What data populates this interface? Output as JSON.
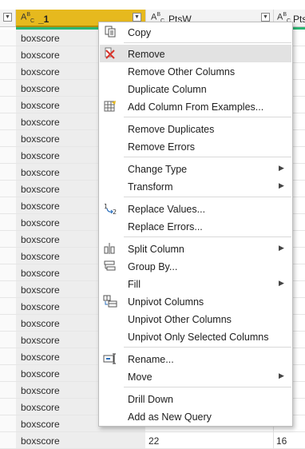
{
  "columns": [
    {
      "type_icon": "ABC",
      "name": "_1",
      "dropdown_icon": "chevron-down-icon"
    },
    {
      "type_icon": "ABC",
      "name": "PtsW",
      "dropdown_icon": "chevron-down-icon"
    },
    {
      "type_icon": "ABC",
      "name": "Pts",
      "dropdown_icon": ""
    }
  ],
  "rows": [
    {
      "c1": "boxscore",
      "c2": "",
      "c3": ""
    },
    {
      "c1": "boxscore",
      "c2": "",
      "c3": ""
    },
    {
      "c1": "boxscore",
      "c2": "",
      "c3": ""
    },
    {
      "c1": "boxscore",
      "c2": "",
      "c3": ""
    },
    {
      "c1": "boxscore",
      "c2": "",
      "c3": ""
    },
    {
      "c1": "boxscore",
      "c2": "",
      "c3": ""
    },
    {
      "c1": "boxscore",
      "c2": "",
      "c3": ""
    },
    {
      "c1": "boxscore",
      "c2": "",
      "c3": ""
    },
    {
      "c1": "boxscore",
      "c2": "",
      "c3": ""
    },
    {
      "c1": "boxscore",
      "c2": "",
      "c3": ""
    },
    {
      "c1": "boxscore",
      "c2": "",
      "c3": ""
    },
    {
      "c1": "boxscore",
      "c2": "",
      "c3": ""
    },
    {
      "c1": "boxscore",
      "c2": "",
      "c3": ""
    },
    {
      "c1": "boxscore",
      "c2": "",
      "c3": ""
    },
    {
      "c1": "boxscore",
      "c2": "",
      "c3": ""
    },
    {
      "c1": "boxscore",
      "c2": "",
      "c3": ""
    },
    {
      "c1": "boxscore",
      "c2": "",
      "c3": ""
    },
    {
      "c1": "boxscore",
      "c2": "",
      "c3": ""
    },
    {
      "c1": "boxscore",
      "c2": "",
      "c3": ""
    },
    {
      "c1": "boxscore",
      "c2": "",
      "c3": ""
    },
    {
      "c1": "boxscore",
      "c2": "",
      "c3": ""
    },
    {
      "c1": "boxscore",
      "c2": "",
      "c3": ""
    },
    {
      "c1": "boxscore",
      "c2": "",
      "c3": ""
    },
    {
      "c1": "boxscore",
      "c2": "",
      "c3": ""
    },
    {
      "c1": "boxscore",
      "c2": "22",
      "c3": "16"
    }
  ],
  "menu": {
    "copy": "Copy",
    "remove": "Remove",
    "remove_other_columns": "Remove Other Columns",
    "duplicate_column": "Duplicate Column",
    "add_column_from_examples": "Add Column From Examples...",
    "remove_duplicates": "Remove Duplicates",
    "remove_errors": "Remove Errors",
    "change_type": "Change Type",
    "transform": "Transform",
    "replace_values": "Replace Values...",
    "replace_errors": "Replace Errors...",
    "split_column": "Split Column",
    "group_by": "Group By...",
    "fill": "Fill",
    "unpivot_columns": "Unpivot Columns",
    "unpivot_other_columns": "Unpivot Other Columns",
    "unpivot_only_selected_columns": "Unpivot Only Selected Columns",
    "rename": "Rename...",
    "move": "Move",
    "drill_down": "Drill Down",
    "add_as_new_query": "Add as New Query"
  },
  "colors": {
    "selected_header": "#e6b91e",
    "quality_bar": "#2bb673",
    "remove_icon": "#d9342b",
    "menu_highlight": "#e2e2e2"
  }
}
